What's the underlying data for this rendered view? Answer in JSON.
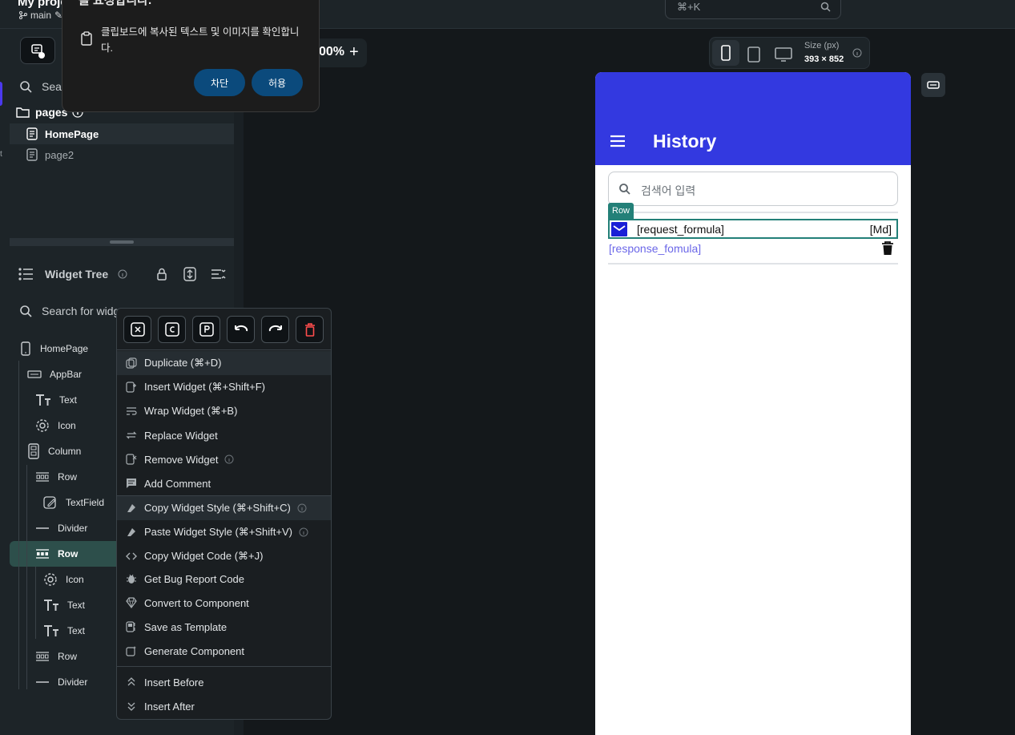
{
  "topbar": {
    "project_title": "My proje",
    "branch": "main",
    "command_search": "⌘+K"
  },
  "dialog": {
    "title": "를 요청합니다.",
    "message": "클립보드에 복사된 텍스트 및 이미지를 확인합니다.",
    "block_label": "차단",
    "allow_label": "허용"
  },
  "canvas": {
    "zoom": "00%",
    "zoom_plus": "+",
    "size_label": "Size (px)",
    "size_value": "393 × 852"
  },
  "left_panel": {
    "rail_label": "t",
    "page_search_placeholder": "Sear",
    "pages_header": "pages",
    "pages": [
      "HomePage",
      "page2"
    ],
    "widget_tree_title": "Widget Tree",
    "widget_search_placeholder": "Search for widg"
  },
  "tree": [
    {
      "label": "HomePage",
      "icon": "phone-icon"
    },
    {
      "label": "AppBar",
      "icon": "appbar-icon"
    },
    {
      "label": "Text",
      "icon": "text-icon"
    },
    {
      "label": "Icon",
      "icon": "gear-icon"
    },
    {
      "label": "Column",
      "icon": "column-icon"
    },
    {
      "label": "Row",
      "icon": "row-icon"
    },
    {
      "label": "TextField",
      "icon": "textfield-icon"
    },
    {
      "label": "Divider",
      "icon": "divider-icon"
    },
    {
      "label": "Row",
      "icon": "row-icon"
    },
    {
      "label": "Icon",
      "icon": "gear-icon"
    },
    {
      "label": "Text",
      "icon": "text-icon"
    },
    {
      "label": "Text",
      "icon": "text-icon"
    },
    {
      "label": "Row",
      "icon": "row-icon"
    },
    {
      "label": "Divider",
      "icon": "divider-icon"
    }
  ],
  "context_menu": {
    "items": [
      "Duplicate (⌘+D)",
      "Insert Widget (⌘+Shift+F)",
      "Wrap Widget (⌘+B)",
      "Replace Widget",
      "Remove Widget",
      "Add Comment",
      "Copy Widget Style (⌘+Shift+C)",
      "Paste Widget Style (⌘+Shift+V)",
      "Copy Widget Code (⌘+J)",
      "Get Bug Report Code",
      "Convert to Component",
      "Save as Template",
      "Generate Component",
      "Insert Before",
      "Insert After"
    ]
  },
  "preview": {
    "appbar_title": "History",
    "search_placeholder": "검색어 입력",
    "row_badge": "Row",
    "request_text": "[request_formula]",
    "md_text": "[Md]",
    "response_text": "[response_fomula]",
    "appbar_color": "#3339e0",
    "selection_color": "#238078"
  },
  "colors": {
    "accent": "#4b39ef",
    "tree_selected": "#2d4f4b",
    "dialog_button": "#0b4a7c"
  }
}
